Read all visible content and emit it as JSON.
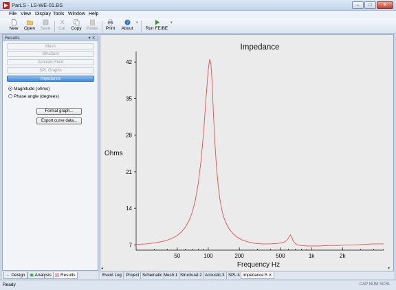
{
  "window": {
    "title": "ParLS - LS-WE-01.BS"
  },
  "menu": [
    "File",
    "View",
    "Display",
    "Tools",
    "Window",
    "Help"
  ],
  "toolbar": {
    "buttons": [
      {
        "label": "New",
        "icon": "new-file-icon",
        "enabled": true
      },
      {
        "label": "Open",
        "icon": "open-folder-icon",
        "enabled": true
      },
      {
        "label": "Save",
        "icon": "save-icon",
        "enabled": false
      },
      {
        "label": "Cut",
        "icon": "cut-icon",
        "enabled": false
      },
      {
        "label": "Copy",
        "icon": "copy-icon",
        "enabled": true
      },
      {
        "label": "Paste",
        "icon": "paste-icon",
        "enabled": false
      },
      {
        "label": "Print",
        "icon": "print-icon",
        "enabled": true
      },
      {
        "label": "About",
        "icon": "help-icon",
        "enabled": true
      },
      {
        "label": "Run FE/BE",
        "icon": "run-icon",
        "enabled": true
      }
    ]
  },
  "panel": {
    "title": "Results",
    "controls": "▾ ✕",
    "buttons": [
      {
        "label": "Mesh",
        "active": false
      },
      {
        "label": "Structure",
        "active": false
      },
      {
        "label": "Acoustic Field",
        "active": false
      },
      {
        "label": "SPL Graphs",
        "active": false
      },
      {
        "label": "Impedance",
        "active": true
      }
    ],
    "radios": [
      {
        "label": "Magnitude (ohms)",
        "checked": true
      },
      {
        "label": "Phase angle (degrees)",
        "checked": false
      }
    ],
    "actions": [
      "Format graph...",
      "Export curve data..."
    ],
    "tabs": [
      {
        "label": "Design",
        "active": false
      },
      {
        "label": "Analysis",
        "active": false
      },
      {
        "label": "Results",
        "active": true
      }
    ]
  },
  "chart_data": {
    "type": "line",
    "title": "Impedance",
    "xlabel": "Frequency Hz",
    "ylabel": "Ohms",
    "xscale": "log",
    "xlim": [
      20,
      5000
    ],
    "ylim": [
      6,
      44
    ],
    "xticks": [
      {
        "value": 50,
        "label": "50"
      },
      {
        "value": 100,
        "label": "100"
      },
      {
        "value": 200,
        "label": "200"
      },
      {
        "value": 500,
        "label": "500"
      },
      {
        "value": 1000,
        "label": "1k"
      },
      {
        "value": 2000,
        "label": "2k"
      }
    ],
    "yticks": [
      7,
      14,
      21,
      28,
      35,
      42
    ],
    "grid": false,
    "color": "#e0504a",
    "series": [
      {
        "x": [
          20,
          25,
          30,
          35,
          40,
          45,
          50,
          55,
          60,
          65,
          70,
          75,
          80,
          85,
          90,
          95,
          100,
          103,
          106,
          109,
          112,
          116,
          120,
          125,
          130,
          135,
          140,
          150,
          160,
          175,
          190,
          210,
          240,
          280,
          330,
          400,
          480,
          540,
          580,
          610,
          625,
          640,
          660,
          690,
          730,
          800,
          900,
          1000,
          1200,
          1500,
          1800,
          2200,
          2700,
          3300,
          4000,
          5000
        ],
        "y": [
          7.1,
          7.2,
          7.4,
          7.6,
          7.9,
          8.3,
          8.8,
          9.5,
          10.4,
          11.6,
          13.3,
          15.6,
          18.8,
          23.0,
          28.5,
          35.0,
          40.5,
          42.5,
          41.8,
          38.0,
          32.5,
          26.5,
          22.0,
          18.2,
          15.6,
          13.8,
          12.5,
          11.0,
          10.0,
          9.1,
          8.5,
          8.0,
          7.6,
          7.3,
          7.2,
          7.2,
          7.3,
          7.5,
          7.9,
          8.6,
          8.9,
          8.6,
          7.9,
          7.3,
          7.0,
          6.9,
          6.8,
          6.8,
          6.8,
          6.9,
          6.9,
          7.0,
          7.0,
          7.1,
          7.2,
          7.2
        ]
      }
    ]
  },
  "doc_tabs": [
    {
      "label": "Event Log",
      "active": false
    },
    {
      "label": "Project",
      "active": false
    },
    {
      "label": "Schematic",
      "active": false
    },
    {
      "label": "Mesh:1",
      "active": false
    },
    {
      "label": "Structural:2",
      "active": false
    },
    {
      "label": "Acoustic:3",
      "active": false
    },
    {
      "label": "SPL:4",
      "active": false
    },
    {
      "label": "Impedance:5",
      "active": true
    }
  ],
  "status": {
    "text": "Ready",
    "keys": "CAP  NUM  SCRL"
  }
}
